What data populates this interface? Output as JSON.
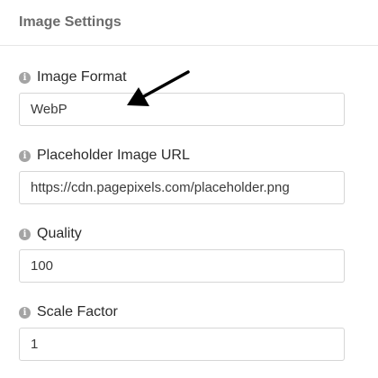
{
  "panel": {
    "title": "Image Settings"
  },
  "fields": [
    {
      "label": "Image Format",
      "value": "WebP",
      "icon": "info-icon"
    },
    {
      "label": "Placeholder Image URL",
      "value": "https://cdn.pagepixels.com/placeholder.png",
      "icon": "info-icon"
    },
    {
      "label": "Quality",
      "value": "100",
      "icon": "info-icon"
    },
    {
      "label": "Scale Factor",
      "value": "1",
      "icon": "info-icon"
    }
  ],
  "info_icon_glyph": "i",
  "colors": {
    "title": "#6b6b6b",
    "icon": "#a4a4a4",
    "border": "#d6d6d6",
    "arrow": "#000000"
  }
}
